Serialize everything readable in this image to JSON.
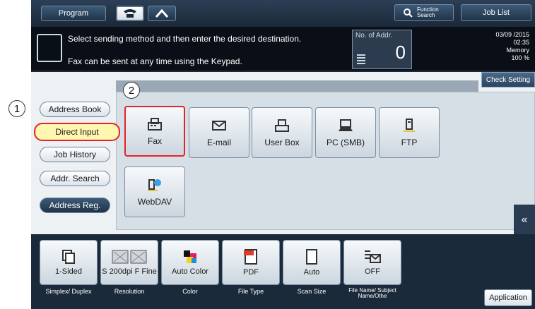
{
  "callouts": [
    "1",
    "2"
  ],
  "topbar": {
    "program_label": "Program",
    "search_label": "Function Search",
    "job_list_label": "Job List"
  },
  "message": {
    "line1": "Select sending method and then enter the desired destination.",
    "line2": "Fax can be sent at any time using the Keypad.",
    "addr_label": "No. of Addr.",
    "addr_count": "0",
    "date": "03/09 /2015",
    "time": "02:35",
    "memory_label": "Memory",
    "memory_value": "100 %"
  },
  "check_setting_label": "Check Setting",
  "sidebar": {
    "items": [
      {
        "label": "Address Book"
      },
      {
        "label": "Direct Input"
      },
      {
        "label": "Job History"
      },
      {
        "label": "Addr. Search"
      },
      {
        "label": "Address Reg."
      }
    ]
  },
  "destinations": [
    {
      "label": "Fax",
      "icon": "fax-icon"
    },
    {
      "label": "E-mail",
      "icon": "email-icon"
    },
    {
      "label": "User Box",
      "icon": "user-box-icon"
    },
    {
      "label": "PC (SMB)",
      "icon": "pc-icon"
    },
    {
      "label": "FTP",
      "icon": "ftp-icon"
    },
    {
      "label": "WebDAV",
      "icon": "webdav-icon"
    }
  ],
  "settings": [
    {
      "value": "1-Sided",
      "label": "Simplex/ Duplex"
    },
    {
      "value": "S 200dpi F Fine",
      "label": "Resolution"
    },
    {
      "value": "Auto Color",
      "label": "Color"
    },
    {
      "value": "PDF",
      "label": "File Type"
    },
    {
      "value": "Auto",
      "label": "Scan Size"
    },
    {
      "value": "OFF",
      "label": "File Name/ Subject Name/Othe"
    }
  ],
  "application_label": "Application",
  "colors": {
    "highlight": "#e3232a",
    "dark_panel": "#1b2a3a"
  }
}
